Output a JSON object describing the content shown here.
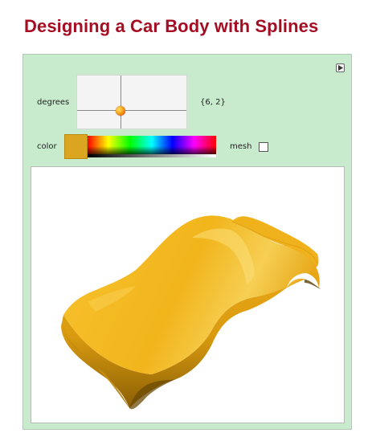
{
  "title": "Designing a Car Body with Splines",
  "controls": {
    "degrees_label": "degrees",
    "degrees_value": "{6, 2}",
    "color_label": "color",
    "mesh_label": "mesh",
    "mesh_checked": false
  },
  "colors": {
    "title": "#a50d22",
    "panel_background": "#c8ebcd",
    "selected_color": "#dba520",
    "car_surface": "#f2b81f"
  },
  "icons": {
    "panel_toggle": "triangle-right-icon",
    "slider_knob": "locator-knob-icon"
  }
}
